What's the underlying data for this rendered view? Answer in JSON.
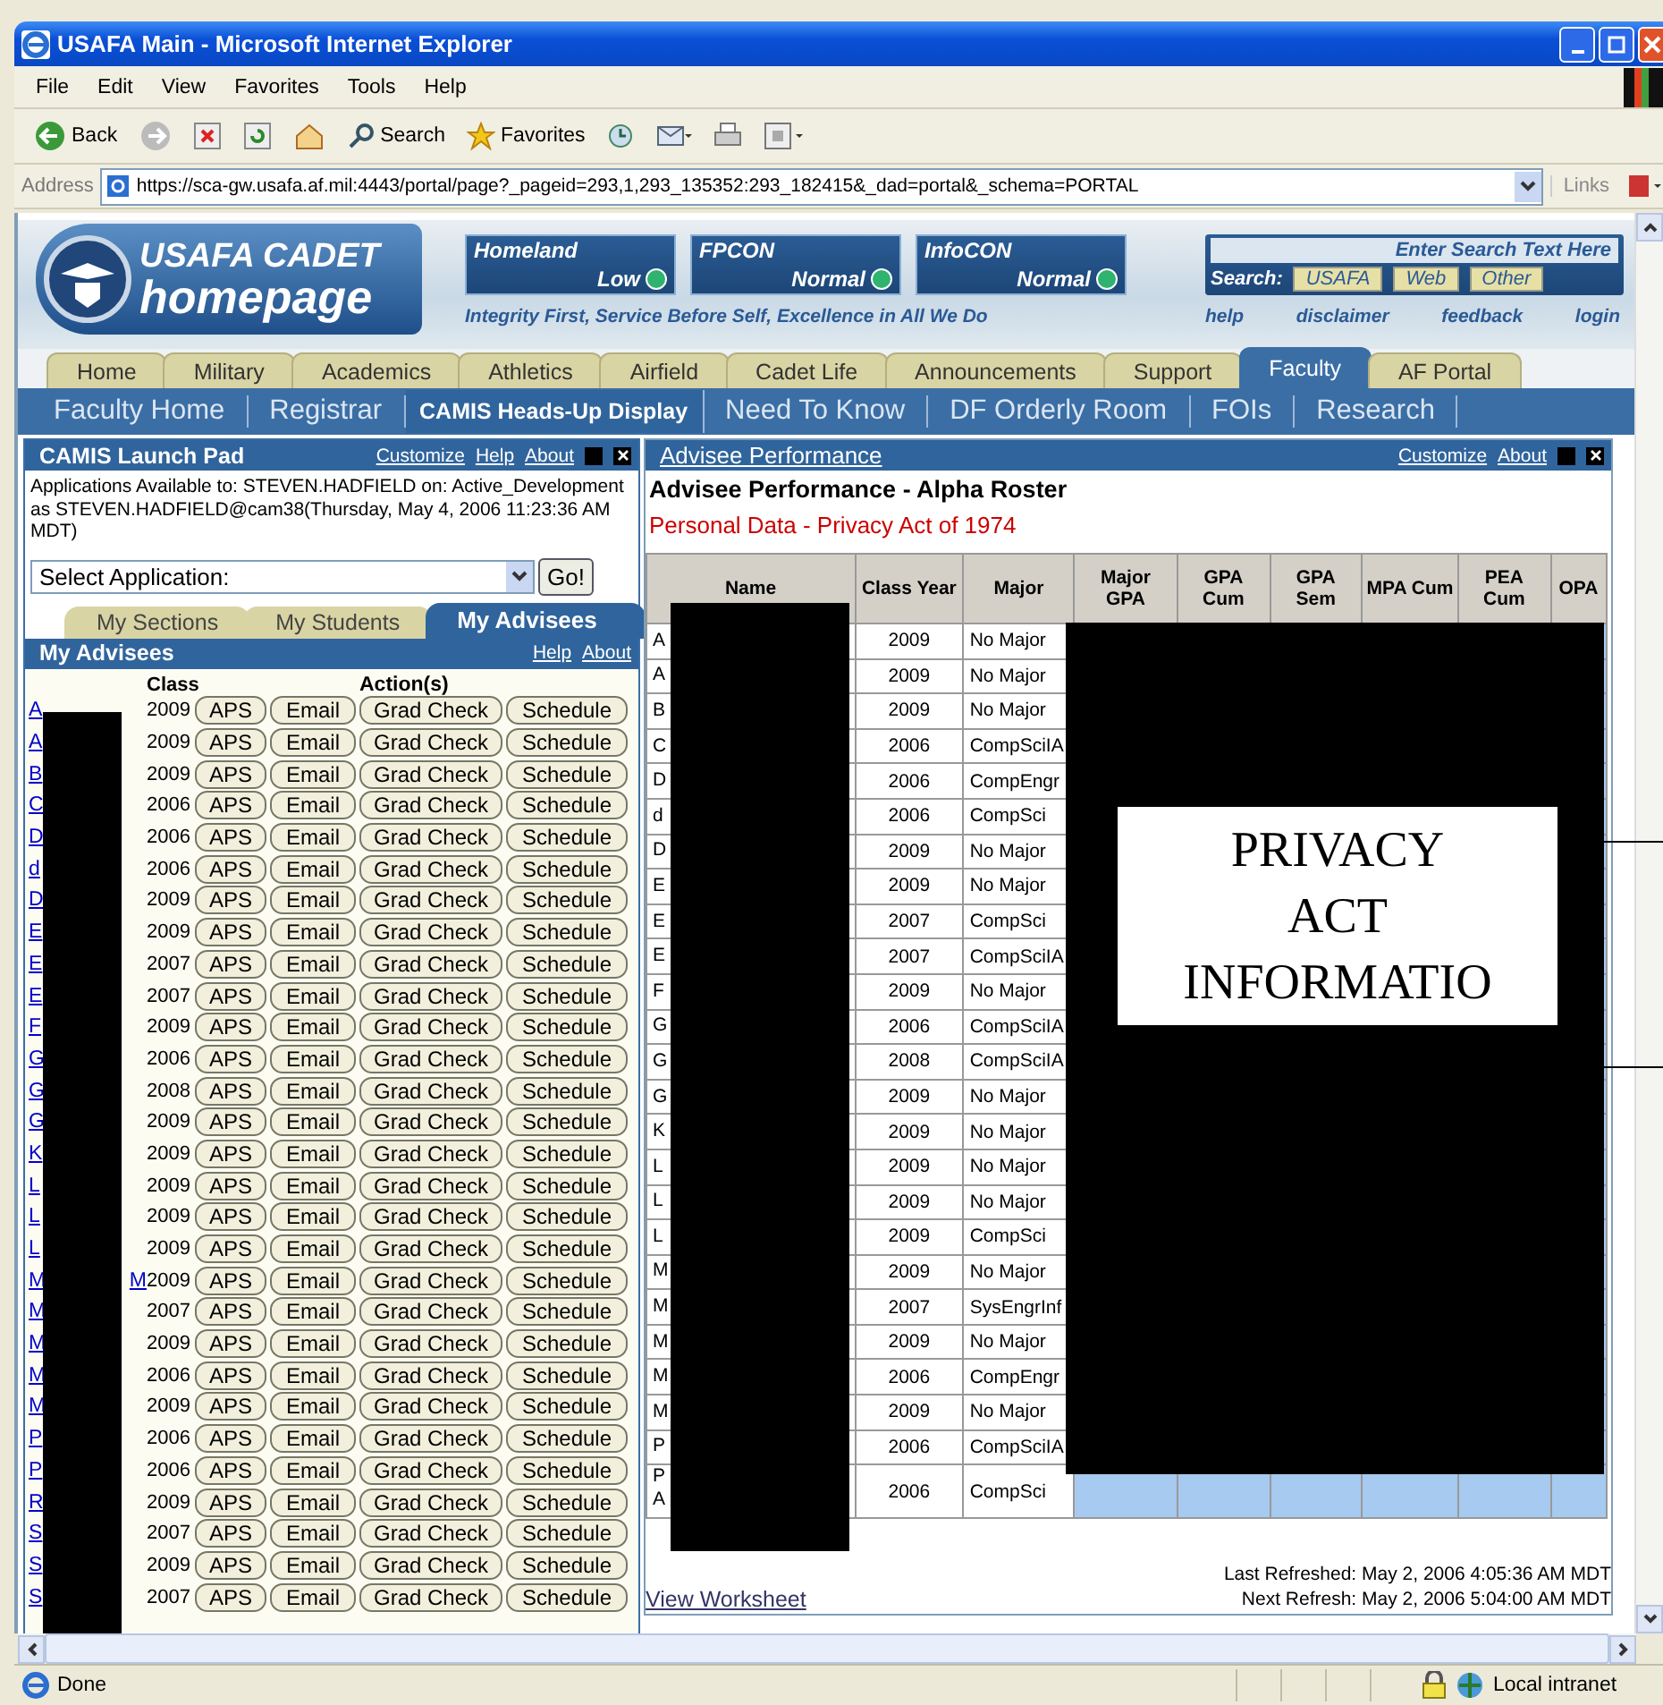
{
  "window": {
    "title": "USAFA Main - Microsoft Internet Explorer"
  },
  "menu": [
    "File",
    "Edit",
    "View",
    "Favorites",
    "Tools",
    "Help"
  ],
  "toolbar": [
    {
      "kind": "back",
      "label": "Back"
    },
    {
      "kind": "forward"
    },
    {
      "kind": "stop"
    },
    {
      "kind": "refresh"
    },
    {
      "kind": "home"
    },
    {
      "kind": "search",
      "label": "Search"
    },
    {
      "kind": "favorites",
      "label": "Favorites"
    },
    {
      "kind": "history"
    },
    {
      "kind": "mail"
    },
    {
      "kind": "print"
    },
    {
      "kind": "page"
    }
  ],
  "address": {
    "label": "Address",
    "value": "https://sca-gw.usafa.af.mil:4443/portal/page?_pageid=293,1,293_135352:293_182415&_dad=portal&_schema=PORTAL",
    "links": "Links"
  },
  "banner": {
    "logo_top": "USAFA CADET",
    "logo_bottom": "homepage",
    "indicators": [
      {
        "name": "Homeland",
        "value": "Low"
      },
      {
        "name": "FPCON",
        "value": "Normal"
      },
      {
        "name": "InfoCON",
        "value": "Normal"
      }
    ],
    "motto": "Integrity First, Service Before Self, Excellence in All We Do",
    "search": {
      "placeholder": "Enter Search Text Here",
      "label": "Search:",
      "scopes": [
        "USAFA",
        "Web",
        "Other"
      ]
    },
    "links": [
      "help",
      "disclaimer",
      "feedback",
      "login"
    ]
  },
  "main_tabs": [
    {
      "label": "Home",
      "selected": false
    },
    {
      "label": "Military",
      "selected": false
    },
    {
      "label": "Academics",
      "selected": false
    },
    {
      "label": "Athletics",
      "selected": false
    },
    {
      "label": "Airfield",
      "selected": false
    },
    {
      "label": "Cadet Life",
      "selected": false
    },
    {
      "label": "Announcements",
      "selected": false
    },
    {
      "label": "Support",
      "selected": false
    },
    {
      "label": "Faculty",
      "selected": true
    },
    {
      "label": "AF Portal",
      "selected": false
    }
  ],
  "sub_tabs": [
    {
      "label": "Faculty Home",
      "selected": false
    },
    {
      "label": "Registrar",
      "selected": false
    },
    {
      "label": "CAMIS Heads-Up Display",
      "selected": true
    },
    {
      "label": "Need To Know",
      "selected": false
    },
    {
      "label": "DF Orderly Room",
      "selected": false
    },
    {
      "label": "FOIs",
      "selected": false
    },
    {
      "label": "Research",
      "selected": false
    }
  ],
  "launch_pad": {
    "title": "CAMIS Launch Pad",
    "links": [
      "Customize",
      "Help",
      "About"
    ],
    "info": "Applications Available to: STEVEN.HADFIELD on: Active_Development as STEVEN.HADFIELD@cam38(Thursday, May 4, 2006 11:23:36 AM MDT)",
    "select": "Select Application:",
    "go": "Go!"
  },
  "advisor_tabs": [
    {
      "label": "My Sections",
      "selected": false
    },
    {
      "label": "My Students",
      "selected": false
    },
    {
      "label": "My Advisees",
      "selected": true
    }
  ],
  "advisees": {
    "title": "My Advisees",
    "links": [
      "Help",
      "About"
    ],
    "columns": [
      "Class",
      "Action(s)"
    ],
    "rows": [
      {
        "name": "A",
        "class": "2009",
        "actions": [
          "APS",
          "Email",
          "Grad Check",
          "Schedule"
        ]
      },
      {
        "name": "A",
        "class": "2009",
        "actions": [
          "APS",
          "Email",
          "Grad Check",
          "Schedule"
        ]
      },
      {
        "name": "B",
        "class": "2009",
        "actions": [
          "APS",
          "Email",
          "Grad Check",
          "Schedule"
        ]
      },
      {
        "name": "C",
        "class": "2006",
        "actions": [
          "APS",
          "Email",
          "Grad Check",
          "Schedule"
        ]
      },
      {
        "name": "D",
        "class": "2006",
        "actions": [
          "APS",
          "Email",
          "Grad Check",
          "Schedule"
        ]
      },
      {
        "name": "d",
        "class": "2006",
        "actions": [
          "APS",
          "Email",
          "Grad Check",
          "Schedule"
        ]
      },
      {
        "name": "D",
        "class": "2009",
        "actions": [
          "APS",
          "Email",
          "Grad Check",
          "Schedule"
        ]
      },
      {
        "name": "E",
        "class": "2009",
        "actions": [
          "APS",
          "Email",
          "Grad Check",
          "Schedule"
        ]
      },
      {
        "name": "E",
        "class": "2007",
        "actions": [
          "APS",
          "Email",
          "Grad Check",
          "Schedule"
        ]
      },
      {
        "name": "E",
        "class": "2007",
        "actions": [
          "APS",
          "Email",
          "Grad Check",
          "Schedule"
        ]
      },
      {
        "name": "F",
        "class": "2009",
        "actions": [
          "APS",
          "Email",
          "Grad Check",
          "Schedule"
        ]
      },
      {
        "name": "G",
        "class": "2006",
        "actions": [
          "APS",
          "Email",
          "Grad Check",
          "Schedule"
        ]
      },
      {
        "name": "G",
        "class": "2008",
        "actions": [
          "APS",
          "Email",
          "Grad Check",
          "Schedule"
        ]
      },
      {
        "name": "G",
        "class": "2009",
        "actions": [
          "APS",
          "Email",
          "Grad Check",
          "Schedule"
        ]
      },
      {
        "name": "K",
        "class": "2009",
        "actions": [
          "APS",
          "Email",
          "Grad Check",
          "Schedule"
        ]
      },
      {
        "name": "L",
        "class": "2009",
        "actions": [
          "APS",
          "Email",
          "Grad Check",
          "Schedule"
        ]
      },
      {
        "name": "L",
        "class": "2009",
        "actions": [
          "APS",
          "Email",
          "Grad Check",
          "Schedule"
        ]
      },
      {
        "name": "L",
        "class": "2009",
        "actions": [
          "APS",
          "Email",
          "Grad Check",
          "Schedule"
        ]
      },
      {
        "name": "M",
        "name_tail": "M",
        "class": "2009",
        "actions": [
          "APS",
          "Email",
          "Grad Check",
          "Schedule"
        ]
      },
      {
        "name": "M",
        "class": "2007",
        "actions": [
          "APS",
          "Email",
          "Grad Check",
          "Schedule"
        ]
      },
      {
        "name": "M",
        "class": "2009",
        "actions": [
          "APS",
          "Email",
          "Grad Check",
          "Schedule"
        ]
      },
      {
        "name": "M",
        "class": "2006",
        "actions": [
          "APS",
          "Email",
          "Grad Check",
          "Schedule"
        ]
      },
      {
        "name": "M",
        "class": "2009",
        "actions": [
          "APS",
          "Email",
          "Grad Check",
          "Schedule"
        ]
      },
      {
        "name": "P",
        "class": "2006",
        "actions": [
          "APS",
          "Email",
          "Grad Check",
          "Schedule"
        ]
      },
      {
        "name": "P",
        "class": "2006",
        "actions": [
          "APS",
          "Email",
          "Grad Check",
          "Schedule"
        ]
      },
      {
        "name": "R",
        "class": "2009",
        "actions": [
          "APS",
          "Email",
          "Grad Check",
          "Schedule"
        ]
      },
      {
        "name": "S",
        "class": "2007",
        "actions": [
          "APS",
          "Email",
          "Grad Check",
          "Schedule"
        ]
      },
      {
        "name": "S",
        "class": "2009",
        "actions": [
          "APS",
          "Email",
          "Grad Check",
          "Schedule"
        ]
      },
      {
        "name": "S",
        "class": "2007",
        "actions": [
          "APS",
          "Email",
          "Grad Check",
          "Schedule"
        ]
      }
    ]
  },
  "performance": {
    "title": "Advisee Performance",
    "links": [
      "Customize",
      "About"
    ],
    "heading": "Advisee Performance - Alpha Roster",
    "notice": "Personal Data - Privacy Act of 1974",
    "columns": [
      "Name",
      "Class Year",
      "Major",
      "Major GPA",
      "GPA Cum",
      "GPA Sem",
      "MPA Cum",
      "PEA Cum",
      "OPA"
    ],
    "rows": [
      {
        "name": "A",
        "year": "2009",
        "major": "No Major"
      },
      {
        "name": "A",
        "year": "2009",
        "major": "No Major"
      },
      {
        "name": "B",
        "year": "2009",
        "major": "No Major"
      },
      {
        "name": "C",
        "year": "2006",
        "major": "CompSciIA"
      },
      {
        "name": "D",
        "year": "2006",
        "major": "CompEngr"
      },
      {
        "name": "d",
        "year": "2006",
        "major": "CompSci"
      },
      {
        "name": "D",
        "year": "2009",
        "major": "No Major"
      },
      {
        "name": "E",
        "year": "2009",
        "major": "No Major"
      },
      {
        "name": "E",
        "year": "2007",
        "major": "CompSci"
      },
      {
        "name": "E",
        "year": "2007",
        "major": "CompSciIA"
      },
      {
        "name": "F",
        "year": "2009",
        "major": "No Major"
      },
      {
        "name": "G",
        "year": "2006",
        "major": "CompSciIA"
      },
      {
        "name": "G",
        "year": "2008",
        "major": "CompSciIA"
      },
      {
        "name": "G",
        "year": "2009",
        "major": "No Major"
      },
      {
        "name": "K",
        "year": "2009",
        "major": "No Major"
      },
      {
        "name": "L",
        "year": "2009",
        "major": "No Major"
      },
      {
        "name": "L",
        "year": "2009",
        "major": "No Major"
      },
      {
        "name": "L",
        "year": "2009",
        "major": "CompSci"
      },
      {
        "name": "M",
        "year": "2009",
        "major": "No Major"
      },
      {
        "name": "M",
        "year": "2007",
        "major": "SysEngrInf"
      },
      {
        "name": "M",
        "year": "2009",
        "major": "No Major"
      },
      {
        "name": "M",
        "year": "2006",
        "major": "CompEngr"
      },
      {
        "name": "M",
        "year": "2009",
        "major": "No Major"
      },
      {
        "name": "P",
        "year": "2006",
        "major": "CompSciIA"
      },
      {
        "name": "P",
        "name_line2": "A",
        "year": "2006",
        "major": "CompSci"
      }
    ],
    "redaction_label": "PRIVACY ACT INFORMATIO",
    "view_link": "View Worksheet",
    "refresh": [
      "Last Refreshed: May 2, 2006 4:05:36 AM MDT",
      "Next Refresh: May 2, 2006 5:04:00 AM MDT"
    ]
  },
  "status_bar": {
    "text": "Done",
    "zone": "Local intranet"
  }
}
